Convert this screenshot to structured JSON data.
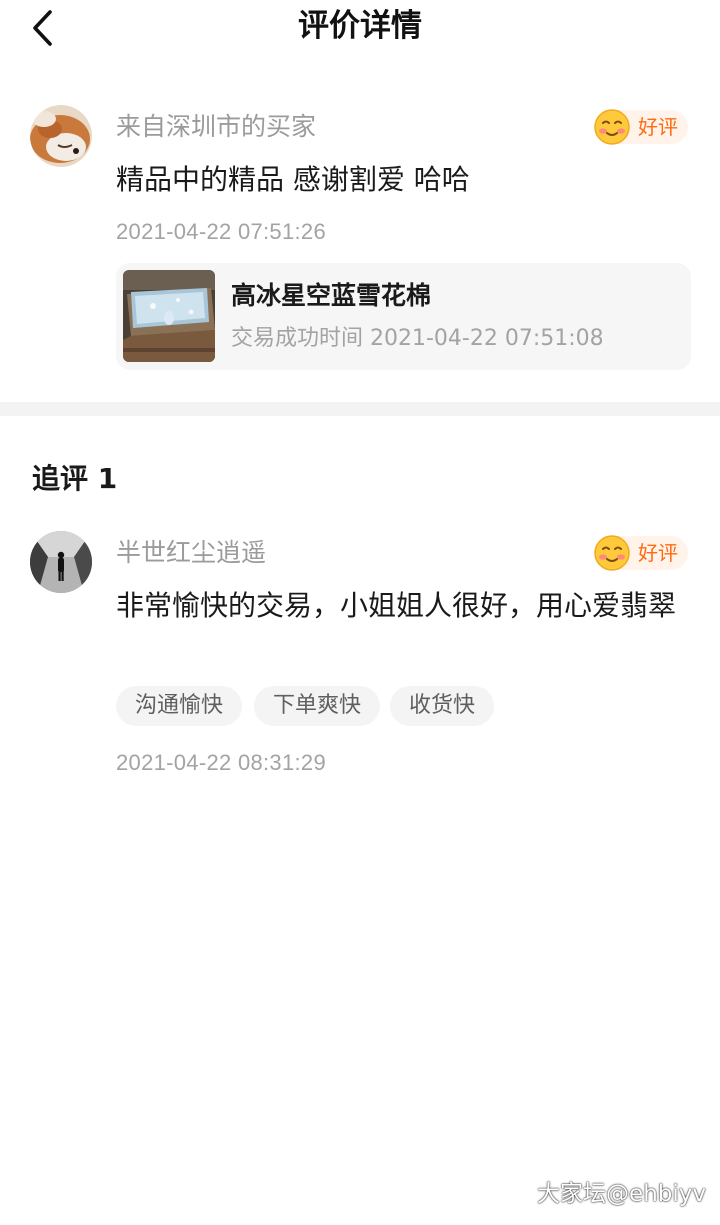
{
  "header": {
    "title": "评价详情",
    "back_icon": "chevron-left-icon"
  },
  "review": {
    "reviewer_name": "来自深圳市的买家",
    "avatar": "fox-avatar",
    "rating_label": "好评",
    "rating_icon": "smiling-face-icon",
    "text": "精品中的精品 感谢割爱 哈哈",
    "timestamp": "2021-04-22 07:51:26",
    "product": {
      "title": "高冰星空蓝雪花棉",
      "meta": "交易成功时间 2021-04-22 07:51:08"
    }
  },
  "followup": {
    "section_title": "追评 1",
    "reviewer_name": "半世红尘逍遥",
    "avatar": "person-walking-avatar",
    "rating_label": "好评",
    "rating_icon": "smiling-face-icon",
    "text": "非常愉快的交易，小姐姐人很好，用心爱翡翠",
    "tags": [
      "沟通愉快",
      "下单爽快",
      "收货快"
    ],
    "timestamp": "2021-04-22 08:31:29"
  },
  "watermark": "大家坛@ehbiyv",
  "colors": {
    "accent": "#ff6a13",
    "badge_bg": "#fff3ea",
    "muted_text": "#9b9b9b",
    "card_bg": "#f6f6f6",
    "divider": "#f3f3f3"
  }
}
